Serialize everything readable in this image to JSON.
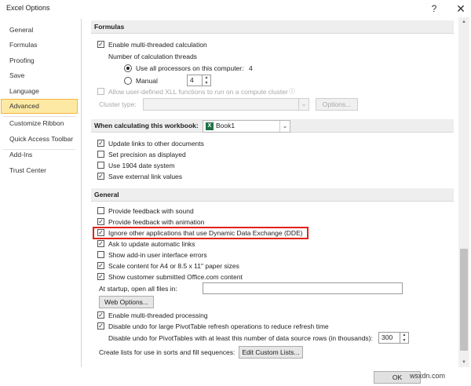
{
  "window": {
    "title": "Excel Options",
    "help_glyph": "?",
    "close_glyph": "✕"
  },
  "sidebar": {
    "items": [
      {
        "label": "General"
      },
      {
        "label": "Formulas"
      },
      {
        "label": "Proofing"
      },
      {
        "label": "Save"
      },
      {
        "label": "Language"
      },
      {
        "label": "Advanced",
        "active": true
      },
      {
        "label": "Customize Ribbon"
      },
      {
        "label": "Quick Access Toolbar"
      },
      {
        "label": "Add-Ins"
      },
      {
        "label": "Trust Center"
      }
    ]
  },
  "formulas": {
    "header": "Formulas",
    "multithread": {
      "label": "Enable multi-threaded calculation",
      "checked": true
    },
    "threads_label": "Number of calculation threads",
    "use_all": {
      "label": "Use all processors on this computer:",
      "value": "4"
    },
    "manual": {
      "label": "Manual",
      "value": "4"
    },
    "allow_udf": {
      "label": "Allow user-defined XLL functions to run on a compute cluster"
    },
    "cluster_type": {
      "label": "Cluster type:",
      "options_button": "Options..."
    }
  },
  "workbook": {
    "header": "When calculating this workbook:",
    "selected_book": "Book1",
    "items": [
      {
        "label": "Update links to other documents",
        "checked": true
      },
      {
        "label": "Set precision as displayed",
        "checked": false
      },
      {
        "label": "Use 1904 date system",
        "checked": false
      },
      {
        "label": "Save external link values",
        "checked": true
      }
    ]
  },
  "general": {
    "header": "General",
    "items": [
      {
        "label": "Provide feedback with sound",
        "checked": false
      },
      {
        "label": "Provide feedback with animation",
        "checked": true
      },
      {
        "label": "Ignore other applications that use Dynamic Data Exchange (DDE)",
        "checked": true
      },
      {
        "label": "Ask to update automatic links",
        "checked": true
      },
      {
        "label": "Show add-in user interface errors",
        "checked": false
      },
      {
        "label": "Scale content for A4 or 8.5 x 11\" paper sizes",
        "checked": true
      },
      {
        "label": "Show customer submitted Office.com content",
        "checked": true
      }
    ],
    "startup_label": "At startup, open all files in:",
    "startup_value": "",
    "web_options_button": "Web Options...",
    "multi_processing": {
      "label": "Enable multi-threaded processing",
      "checked": true
    },
    "disable_undo_large": {
      "label": "Disable undo for large PivotTable refresh operations to reduce refresh time",
      "checked": true
    },
    "undo_rows_label": "Disable undo for PivotTables with at least this number of data source rows (in thousands):",
    "undo_rows_value": "300",
    "custom_lists_label": "Create lists for use in sorts and fill sequences:",
    "custom_lists_button": "Edit Custom Lists..."
  },
  "footer": {
    "ok_button": "OK",
    "watermark": "wsxdn.com"
  },
  "colors": {
    "highlight": "#e2231a",
    "active_nav": "#fde9a3",
    "active_nav_border": "#f3b53d"
  }
}
